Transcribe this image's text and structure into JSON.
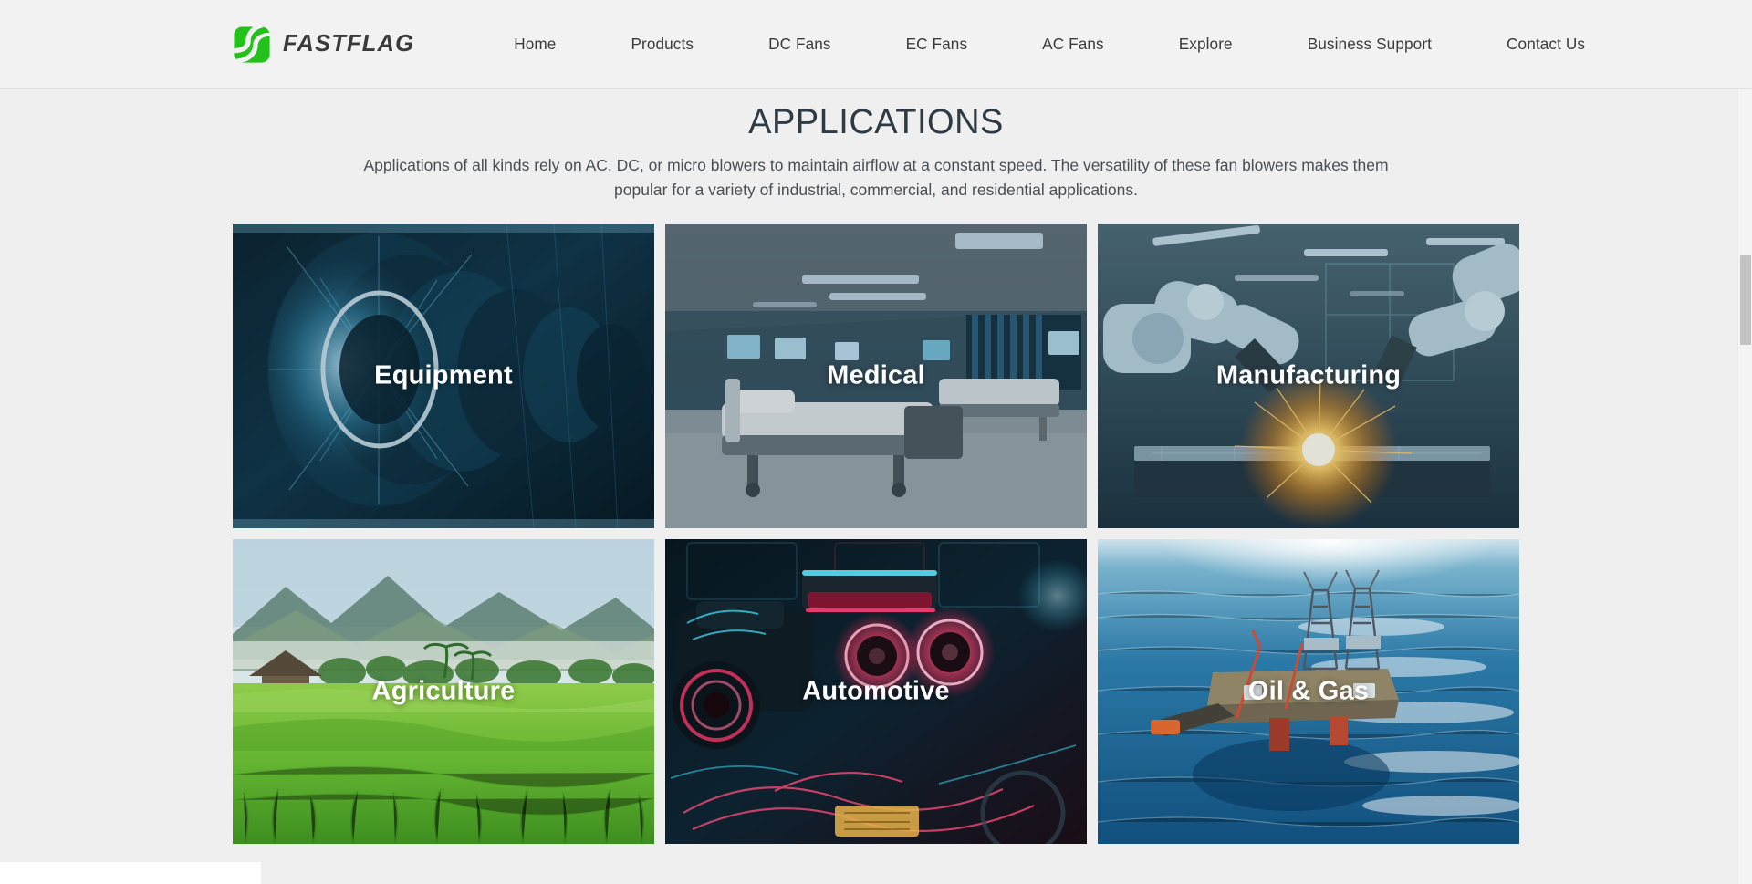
{
  "header": {
    "brand": {
      "logo_icon": "fastflag-swirl-logo",
      "wordmark": "FASTFLAG",
      "logo_color": "#22c21b"
    },
    "nav_items": [
      {
        "label": "Home"
      },
      {
        "label": "Products"
      },
      {
        "label": "DC Fans"
      },
      {
        "label": "EC Fans"
      },
      {
        "label": "AC Fans"
      },
      {
        "label": "Explore"
      },
      {
        "label": "Business Support"
      },
      {
        "label": "Contact Us"
      }
    ]
  },
  "main": {
    "title": "APPLICATIONS",
    "intro": "Applications of all kinds rely on AC, DC, or micro blowers to maintain airflow at a constant speed. The versatility of these fan blowers makes them popular for a variety of industrial, commercial, and residential applications.",
    "accent_color": "#17a295",
    "cards": [
      {
        "label": "Equipment",
        "image": "turbine-jet-engine-blue",
        "active": false
      },
      {
        "label": "Medical",
        "image": "hospital-room-beds",
        "active": false
      },
      {
        "label": "Manufacturing",
        "image": "robot-arms-welding",
        "active": true
      },
      {
        "label": "Agriculture",
        "image": "rice-field-green-hills",
        "active": false
      },
      {
        "label": "Automotive",
        "image": "neon-engine-bay",
        "active": false
      },
      {
        "label": "Oil & Gas",
        "image": "offshore-oil-rig-ocean",
        "active": false
      }
    ]
  },
  "scrollbar": {
    "position_label": "page-scroll"
  }
}
